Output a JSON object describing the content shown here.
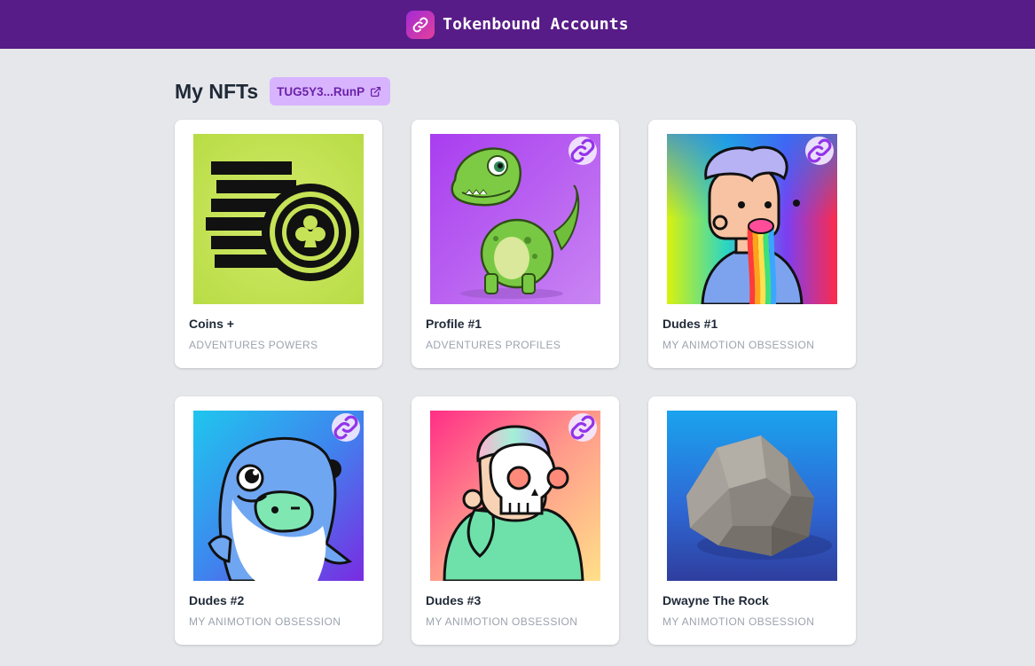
{
  "header": {
    "title": "Tokenbound Accounts",
    "logo_icon": "chain-link-icon",
    "background": "#571c87"
  },
  "main": {
    "title": "My NFTs",
    "address_chip": {
      "label": "TUG5Y3...RunP",
      "icon": "external-link-icon"
    }
  },
  "nfts": [
    {
      "name": "Coins +",
      "collection": "ADVENTURES POWERS",
      "linked": false,
      "image": "coin-stack-image"
    },
    {
      "name": "Profile #1",
      "collection": "ADVENTURES PROFILES",
      "linked": true,
      "image": "dinosaur-image"
    },
    {
      "name": "Dudes #1",
      "collection": "MY ANIMOTION OBSESSION",
      "linked": true,
      "image": "rainbow-dude-image"
    },
    {
      "name": "Dudes #2",
      "collection": "MY ANIMOTION OBSESSION",
      "linked": true,
      "image": "whale-dude-image"
    },
    {
      "name": "Dudes #3",
      "collection": "MY ANIMOTION OBSESSION",
      "linked": true,
      "image": "skull-dude-image"
    },
    {
      "name": "Dwayne The Rock",
      "collection": "MY ANIMOTION OBSESSION",
      "linked": false,
      "image": "rock-image"
    }
  ],
  "colors": {
    "accent": "#571c87",
    "chip_bg": "#d8b4fe",
    "chip_text": "#6b21a8",
    "page_bg": "#e5e7eb"
  }
}
